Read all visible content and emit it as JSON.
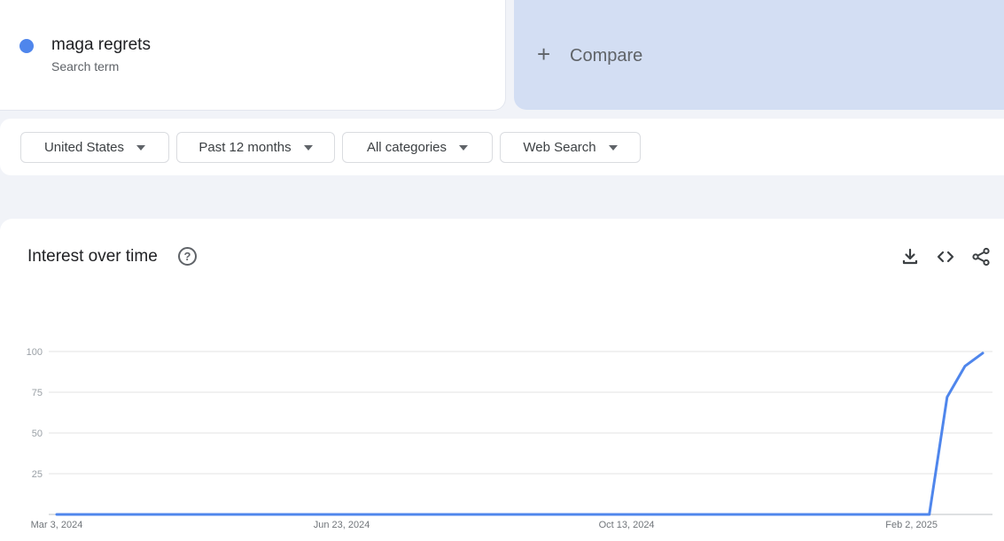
{
  "search_term": {
    "name": "maga regrets",
    "type": "Search term",
    "color": "#4f86ec"
  },
  "compare": {
    "label": "Compare",
    "icon": "plus-icon"
  },
  "filters": [
    {
      "label": "United States"
    },
    {
      "label": "Past 12 months"
    },
    {
      "label": "All categories"
    },
    {
      "label": "Web Search"
    }
  ],
  "chart_section": {
    "title": "Interest over time",
    "icons": [
      "help-icon",
      "download-icon",
      "embed-code-icon",
      "share-icon"
    ]
  },
  "chart_data": {
    "type": "line",
    "ylim": [
      0,
      100
    ],
    "y_ticks": [
      25,
      50,
      75,
      100
    ],
    "x_tick_labels": [
      "Mar 3, 2024",
      "Jun 23, 2024",
      "Oct 13, 2024",
      "Feb 2, 2025"
    ],
    "grid": true,
    "series": [
      {
        "color": "#4f86ec",
        "x": [
          "2024-03-03",
          "2024-03-10",
          "2024-03-17",
          "2024-03-24",
          "2024-03-31",
          "2024-04-07",
          "2024-04-14",
          "2024-04-21",
          "2024-04-28",
          "2024-05-05",
          "2024-05-12",
          "2024-05-19",
          "2024-05-26",
          "2024-06-02",
          "2024-06-09",
          "2024-06-16",
          "2024-06-23",
          "2024-06-30",
          "2024-07-07",
          "2024-07-14",
          "2024-07-21",
          "2024-07-28",
          "2024-08-04",
          "2024-08-11",
          "2024-08-18",
          "2024-08-25",
          "2024-09-01",
          "2024-09-08",
          "2024-09-15",
          "2024-09-22",
          "2024-09-29",
          "2024-10-06",
          "2024-10-13",
          "2024-10-20",
          "2024-10-27",
          "2024-11-03",
          "2024-11-10",
          "2024-11-17",
          "2024-11-24",
          "2024-12-01",
          "2024-12-08",
          "2024-12-15",
          "2024-12-22",
          "2024-12-29",
          "2025-01-05",
          "2025-01-12",
          "2025-01-19",
          "2025-01-26",
          "2025-02-02",
          "2025-02-09",
          "2025-02-16",
          "2025-02-23",
          "2025-03-02"
        ],
        "values": [
          0,
          0,
          0,
          0,
          0,
          0,
          0,
          0,
          0,
          0,
          0,
          0,
          0,
          0,
          0,
          0,
          0,
          0,
          0,
          0,
          0,
          0,
          0,
          0,
          0,
          0,
          0,
          0,
          0,
          0,
          0,
          0,
          0,
          0,
          0,
          0,
          0,
          0,
          0,
          0,
          0,
          0,
          0,
          0,
          0,
          0,
          0,
          0,
          0,
          0,
          72,
          91,
          99
        ]
      }
    ]
  }
}
